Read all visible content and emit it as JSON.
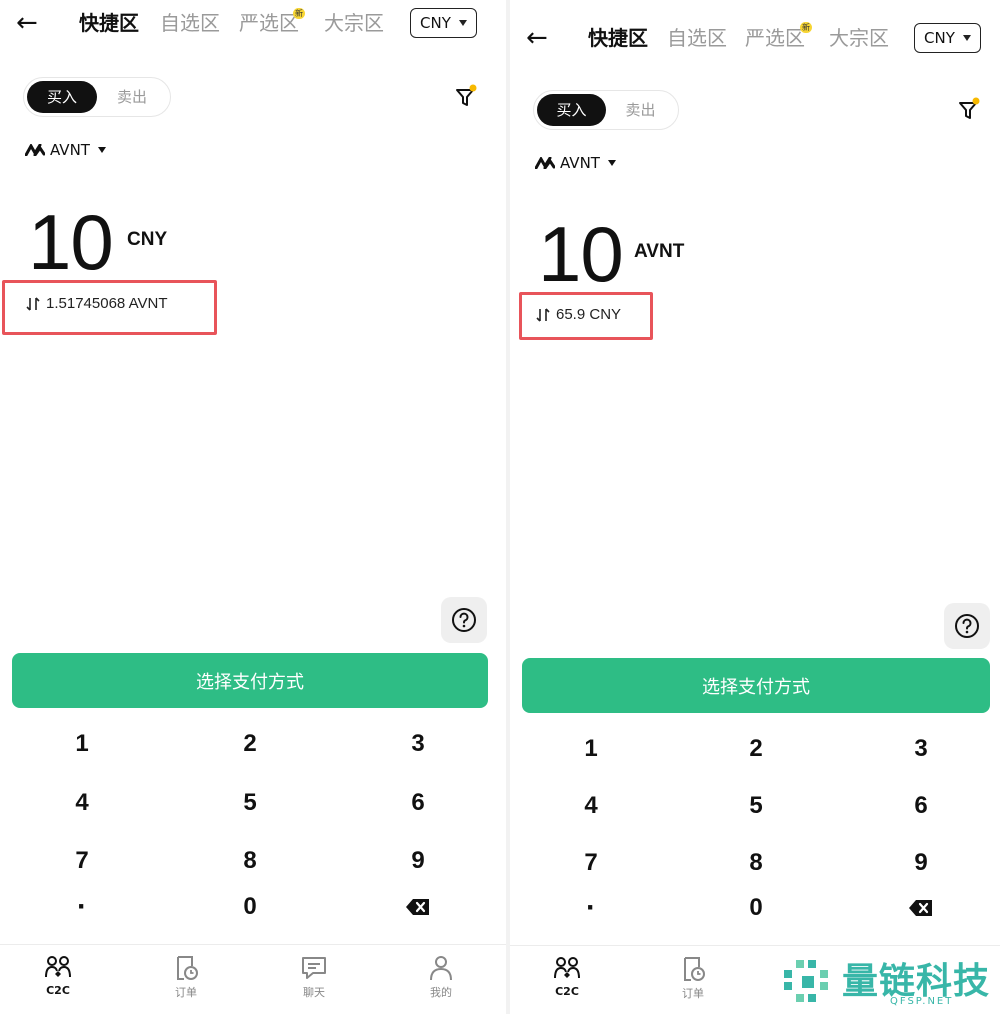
{
  "left": {
    "tabs": [
      "快捷区",
      "自选区",
      "严选区",
      "大宗区"
    ],
    "new_badge": "新",
    "currency": "CNY",
    "buy_label": "买入",
    "sell_label": "卖出",
    "token": "AVNT",
    "amount": "10",
    "amount_unit": "CNY",
    "converted": "1.51745068 AVNT",
    "pay_button": "选择支付方式",
    "keys": [
      "1",
      "2",
      "3",
      "4",
      "5",
      "6",
      "7",
      "8",
      "9",
      "·",
      "0",
      "backspace"
    ],
    "nav": [
      "C2C",
      "订单",
      "聊天",
      "我的"
    ]
  },
  "right": {
    "tabs": [
      "快捷区",
      "自选区",
      "严选区",
      "大宗区"
    ],
    "new_badge": "新",
    "currency": "CNY",
    "buy_label": "买入",
    "sell_label": "卖出",
    "token": "AVNT",
    "amount": "10",
    "amount_unit": "AVNT",
    "converted": "65.9 CNY",
    "pay_button": "选择支付方式",
    "keys": [
      "1",
      "2",
      "3",
      "4",
      "5",
      "6",
      "7",
      "8",
      "9",
      "·",
      "0",
      "backspace"
    ],
    "nav": [
      "C2C",
      "订单"
    ]
  },
  "watermark": {
    "text": "量链科技",
    "sub": "QFSP.NET"
  },
  "colors": {
    "accent_green": "#2ebd85",
    "highlight_red": "#e8545a",
    "badge_yellow": "#f7d533",
    "watermark_teal": "#38b6a8"
  }
}
